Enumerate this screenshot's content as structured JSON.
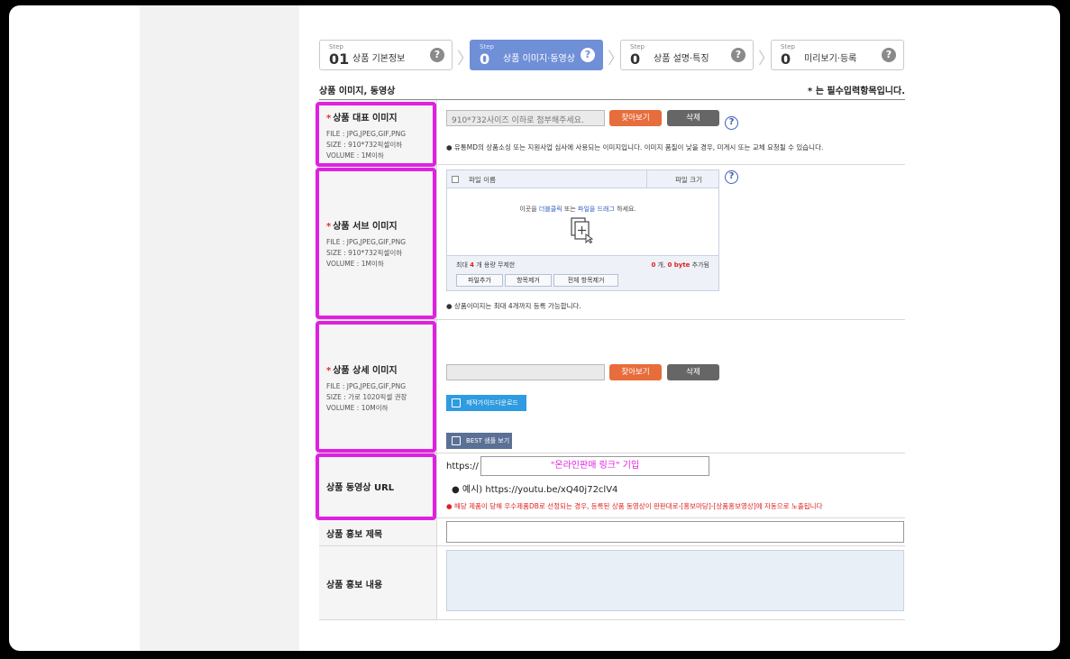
{
  "steps": [
    {
      "label": "Step",
      "num": "01",
      "title": "상품 기본정보",
      "help": "?"
    },
    {
      "label": "Step",
      "num": "0",
      "title": "상품 이미지·동영상",
      "help": "?"
    },
    {
      "label": "Step",
      "num": "0",
      "title": "상품 설명·특징",
      "help": "?"
    },
    {
      "label": "Step",
      "num": "0",
      "title": "미리보기·등록",
      "help": "?"
    }
  ],
  "active_step": 1,
  "section_title": "상품 이미지, 동영상",
  "required_note": "* 는 필수입력항목입니다.",
  "rep_image": {
    "title": "상품 대표 이미지",
    "file": "FILE : JPG,JPEG,GIF,PNG",
    "size": "SIZE : 910*732픽셀이하",
    "volume": "VOLUME : 1M이하",
    "placeholder": "910*732사이즈 이하로 첨부해주세요.",
    "browse": "찾아보기",
    "delete": "삭제",
    "note": "● 유통MD의 상품소싱 또는 지원사업 심사에 사용되는 이미지입니다. 이미지 품질이 낮을 경우, 미게시 또는 교체 요청될 수 있습니다."
  },
  "sub_image": {
    "title": "상품 서브 이미지",
    "file": "FILE : JPG,JPEG,GIF,PNG",
    "size": "SIZE : 910*732픽셀이하",
    "volume": "VOLUME : 1M이하",
    "col_name": "파일 이름",
    "col_size": "파일 크기",
    "drop_pre": "이곳을",
    "drop_dbl": "더블클릭",
    "drop_mid": "또는",
    "drop_drag": "파일을 드래그",
    "drop_post": "하세요.",
    "limit_pre": "최대",
    "limit_num": "4",
    "limit_post": "개 용량 무제한",
    "added_count": "0",
    "added_mid": "개,",
    "added_bytes": "0 byte",
    "added_post": "추가됨",
    "btn_add": "파일추가",
    "btn_remove": "항목제거",
    "btn_remove_all": "전체 항목제거",
    "note": "● 상품이미지는 최대 4개까지 등록 가능합니다."
  },
  "detail_image": {
    "title": "상품 상세 이미지",
    "file": "FILE : JPG,JPEG,GIF,PNG",
    "size": "SIZE : 가로 1020픽셀 권장",
    "volume": "VOLUME : 10M이하",
    "browse": "찾아보기",
    "delete": "삭제",
    "guide_btn": "제작가이드다운로드",
    "best_btn": "BEST 샘플 보기"
  },
  "video": {
    "title": "상품 동영상 URL",
    "prefix": "https://",
    "input_value": "\"온라인판매 링크\" 기입",
    "example": "● 예시)  https://youtu.be/xQ40j72clV4",
    "note": "● 해당 제품이 당해 우수제품DB로 선정되는 경우, 등록된 상품 동영상이 판판대로-[홍보마당]-[상품홍보영상]에 자동으로 노출됩니다"
  },
  "promo_title": {
    "label": "상품 홍보 제목"
  },
  "promo_content": {
    "label": "상품 홍보 내용"
  },
  "colors": {
    "accent_step": "#6f8fd7",
    "highlight": "#e020e0",
    "orange": "#e76d3c"
  }
}
